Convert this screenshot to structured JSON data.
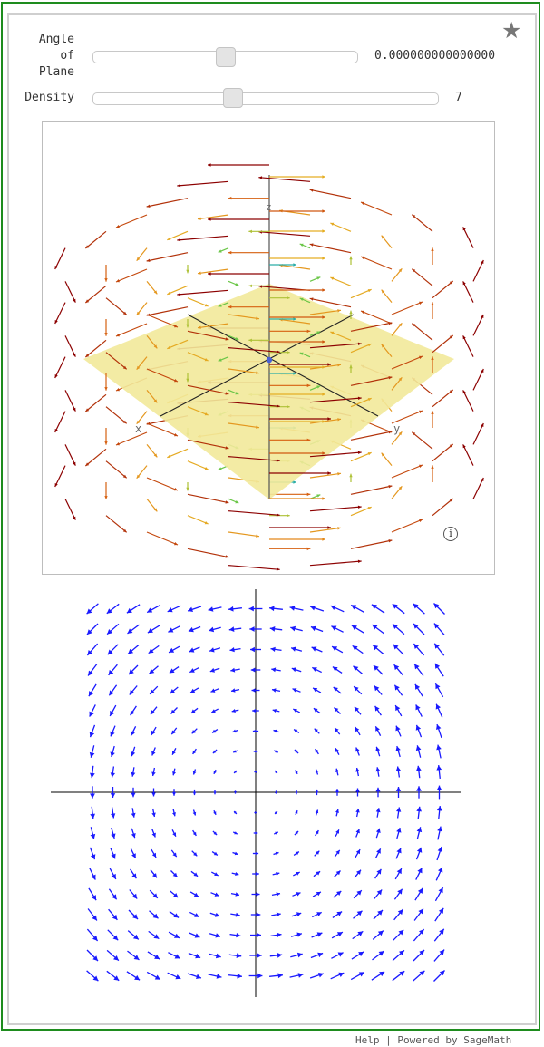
{
  "controls": {
    "angle": {
      "label_lines": [
        "Angle",
        "of",
        "Plane"
      ],
      "value": "0.000000000000000",
      "position_fraction": 0.5
    },
    "density": {
      "label": "Density",
      "value": "7",
      "position_fraction": 0.4
    }
  },
  "plot3d": {
    "axis_labels": {
      "x": "x",
      "y": "y",
      "z": "z"
    },
    "plane_color": "#f2e99a",
    "info_icon": "info-icon"
  },
  "plot2d": {
    "arrow_color": "#1a1aff"
  },
  "star_icon": "star-icon",
  "footer": {
    "help": "Help",
    "separator": "|",
    "powered": "Powered by SageMath"
  }
}
